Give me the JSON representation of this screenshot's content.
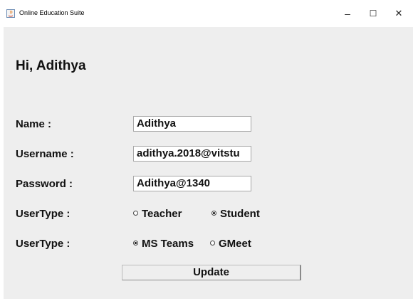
{
  "window": {
    "title": "Online Education Suite",
    "minimize_label": "–",
    "maximize_label": "☐",
    "close_label": "✕"
  },
  "greeting": "Hi, Adithya",
  "form": {
    "name_label": "Name :",
    "name_value": "Adithya",
    "username_label": "Username :",
    "username_value": "adithya.2018@vitstu",
    "password_label": "Password :",
    "password_value": "Adithya@1340",
    "usertype_label_1": "UserType :",
    "usertype_options": [
      {
        "label": "Teacher",
        "selected": false
      },
      {
        "label": "Student",
        "selected": true
      }
    ],
    "usertype_label_2": "UserType :",
    "platform_options": [
      {
        "label": "MS Teams",
        "selected": true
      },
      {
        "label": "GMeet",
        "selected": false
      }
    ],
    "update_label": "Update"
  }
}
